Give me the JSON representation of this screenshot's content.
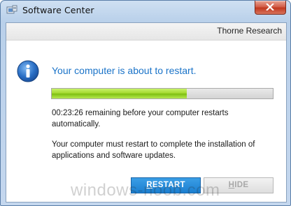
{
  "window": {
    "title": "Software Center"
  },
  "header": {
    "company": "Thorne Research"
  },
  "dialog": {
    "icon": "info-icon",
    "headline": "Your computer is about to restart.",
    "progress_fraction": 0.61,
    "countdown_text": "00:23:26 remaining before your computer restarts automatically.",
    "explanation_text": "Your computer must restart to complete the installation of applications and software updates."
  },
  "buttons": {
    "restart_first": "R",
    "restart_rest": "ESTART",
    "hide_first": "H",
    "hide_rest": "IDE"
  },
  "watermark": "windows-noob.com",
  "colors": {
    "accent_blue": "#1a73c8",
    "progress_green": "#9fd62a",
    "restart_button": "#1b7fd0"
  }
}
